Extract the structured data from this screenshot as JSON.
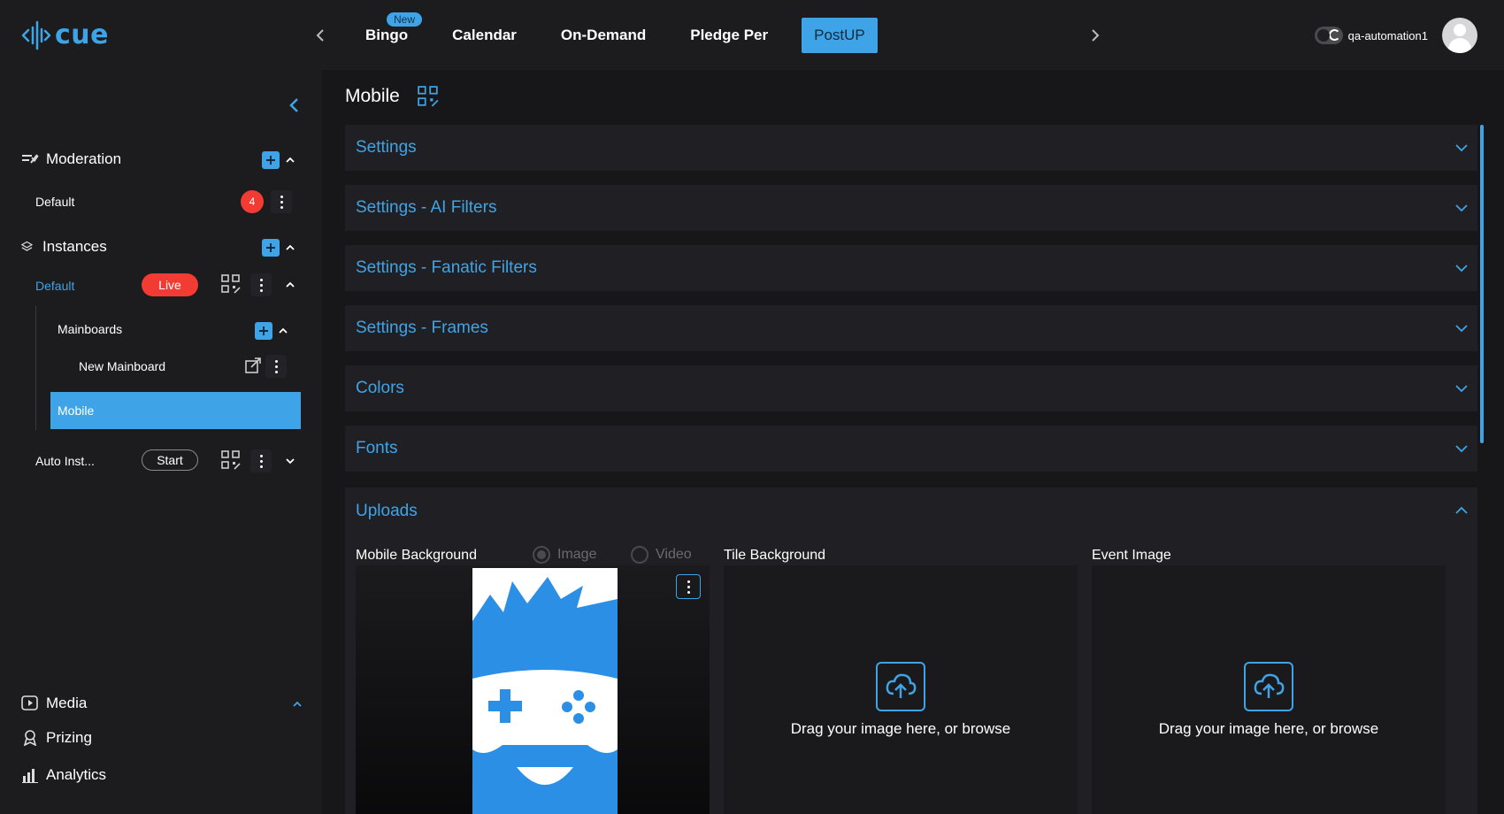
{
  "app": {
    "logo_text": "cue"
  },
  "nav": {
    "tabs": [
      {
        "label": "Bingo",
        "badge": "New"
      },
      {
        "label": "Calendar"
      },
      {
        "label": "On-Demand"
      },
      {
        "label": "Pledge Per"
      },
      {
        "label": "PostUP",
        "active": true
      }
    ]
  },
  "user": {
    "name": "qa-automation1"
  },
  "sidebar": {
    "moderation": {
      "label": "Moderation",
      "items": [
        {
          "label": "Default",
          "count": "4"
        }
      ]
    },
    "instances": {
      "label": "Instances",
      "default": {
        "label": "Default",
        "status": "Live"
      },
      "mainboards": {
        "label": "Mainboards",
        "items": [
          {
            "label": "New Mainboard"
          },
          {
            "label": "Mobile",
            "selected": true
          }
        ]
      },
      "auto": {
        "label": "Auto Inst...",
        "action": "Start"
      }
    },
    "bottom": [
      {
        "label": "Media",
        "icon": "media-icon"
      },
      {
        "label": "Prizing",
        "icon": "award-icon"
      },
      {
        "label": "Analytics",
        "icon": "chart-icon"
      }
    ]
  },
  "main": {
    "title": "Mobile",
    "panels": [
      "Settings",
      "Settings - AI Filters",
      "Settings - Fanatic Filters",
      "Settings - Frames",
      "Colors",
      "Fonts"
    ],
    "uploads": {
      "title": "Uploads",
      "mobile_background": "Mobile Background",
      "radio_image": "Image",
      "radio_video": "Video",
      "tile_background": "Tile Background",
      "event_image": "Event Image",
      "drop_text": "Drag your image here, or browse"
    }
  },
  "colors": {
    "accent": "#3fa4e7",
    "live": "#f23b32",
    "background": "#1c1c1f"
  }
}
